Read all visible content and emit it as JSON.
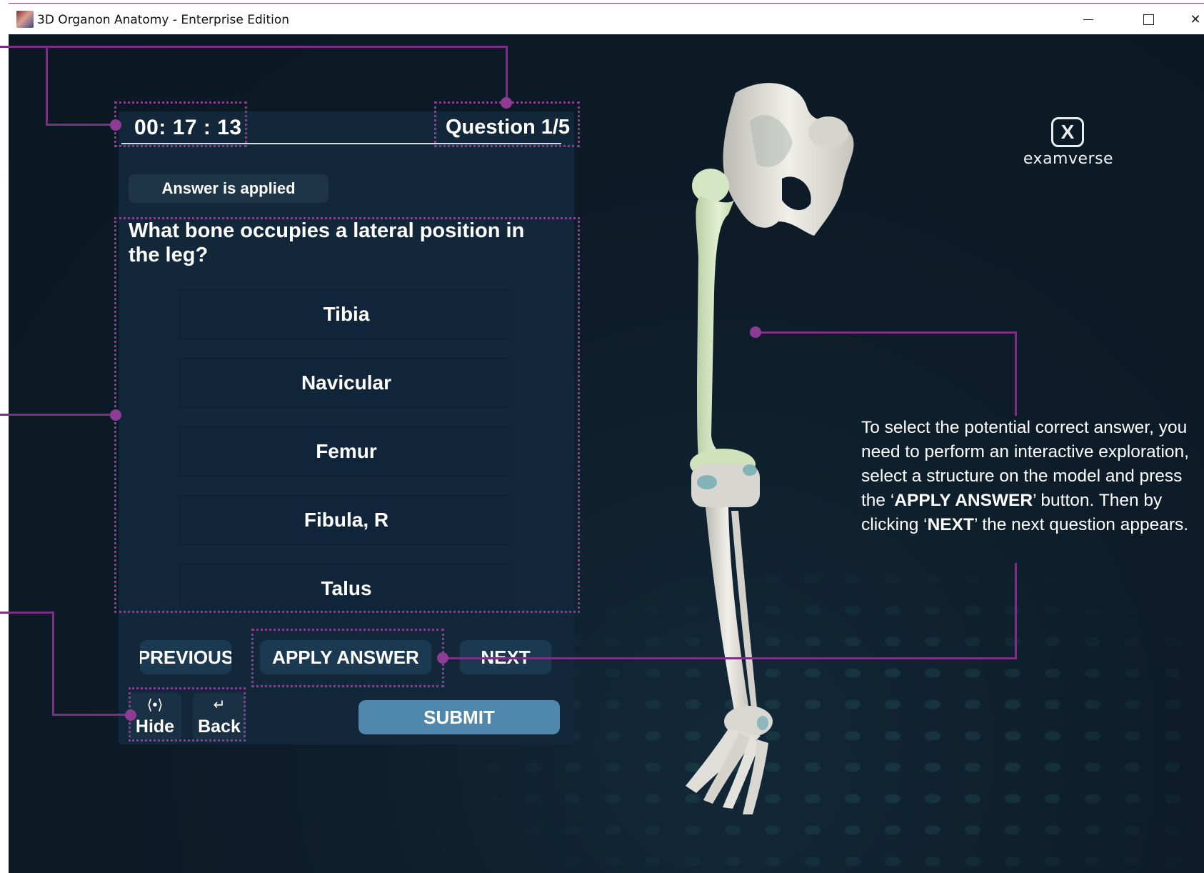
{
  "window": {
    "title": "3D Organon Anatomy - Enterprise Edition",
    "minimize": "minimize",
    "maximize": "maximize",
    "close": "close"
  },
  "quiz": {
    "timer": "00: 17 : 13",
    "counter": "Question 1/5",
    "status_badge": "Answer is applied",
    "question": "What bone occupies a lateral position in the leg?",
    "options": [
      "Tibia",
      "Navicular",
      "Femur",
      "Fibula, R",
      "Talus"
    ],
    "buttons": {
      "previous": "PREVIOUS",
      "apply": "APPLY ANSWER",
      "next": "NEXT",
      "submit": "SUBMIT"
    },
    "tools": {
      "hide_label": "Hide",
      "hide_icon": "eye-icon",
      "back_label": "Back",
      "back_icon": "return-arrow-icon"
    }
  },
  "logo": {
    "mark": "X",
    "text": "examverse"
  },
  "help": {
    "part1": "To select the potential correct answer, you need to perform an interactive exploration, select a structure on the model and press the ‘",
    "bold1": "APPLY ANSWER",
    "part2": "’ button. Then by clicking ‘",
    "bold2": "NEXT",
    "part3": "’ the next question appears."
  },
  "colors": {
    "callout": "#8e3b96",
    "panel": "#13273a",
    "submit": "#4f87ad",
    "highlighted_bone": "#d9ecc4"
  }
}
